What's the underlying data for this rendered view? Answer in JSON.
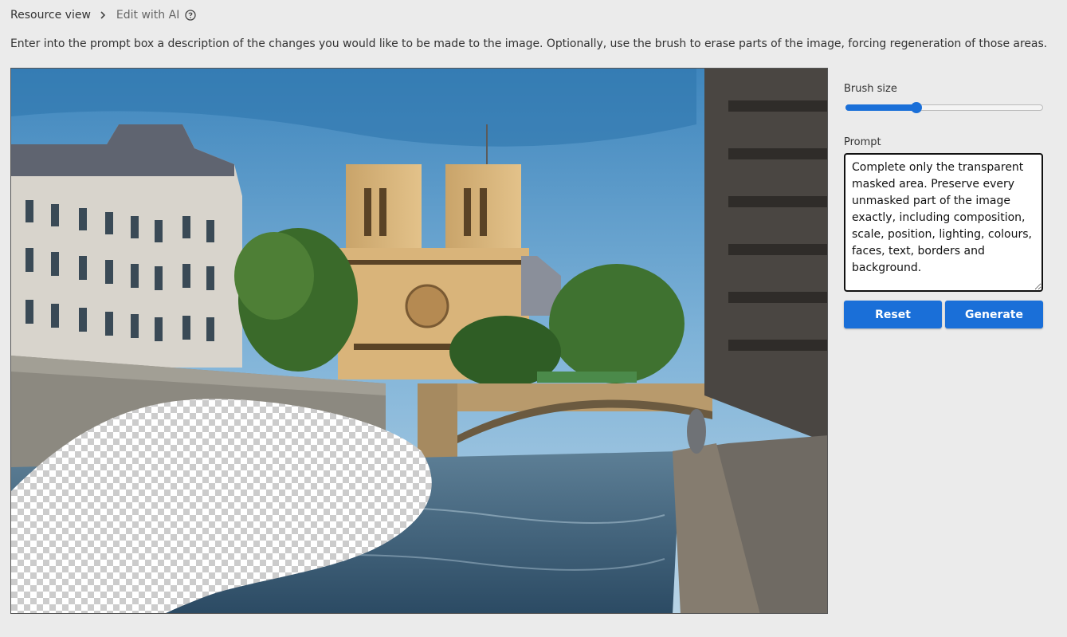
{
  "breadcrumb": {
    "parent": "Resource view",
    "current": "Edit with AI",
    "separator_icon": "chevron-right-icon",
    "help_icon": "question-circle-icon"
  },
  "instructions": "Enter into the prompt box a description of the changes you would like to be made to the image. Optionally, use the brush to erase parts of the image, forcing regeneration of those areas.",
  "editor": {
    "image_alt": "Notre-Dame cathedral and bridge over the Seine river in Paris with a transparent erased area at the bottom-left",
    "mask_style": "transparency-checkerboard"
  },
  "panel": {
    "brush_label": "Brush size",
    "brush_value_fraction": 0.36,
    "prompt_label": "Prompt",
    "prompt_value": "Complete only the transparent masked area. Preserve every unmasked part of the image exactly, including composition, scale, position, lighting, colours, faces, text, borders and background.",
    "reset_label": "Reset",
    "generate_label": "Generate"
  },
  "colors": {
    "accent": "#1a6fd8",
    "page_bg": "#ebebeb"
  }
}
